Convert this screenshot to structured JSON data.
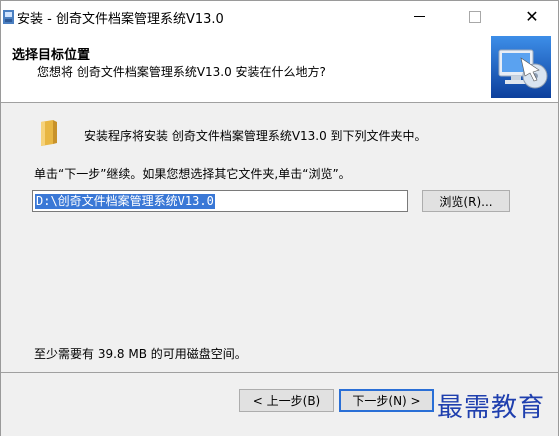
{
  "window": {
    "title": "安装 - 创奇文件档案管理系统V13.0",
    "close_symbol": "✕"
  },
  "header": {
    "title": "选择目标位置",
    "subtitle": "您想将 创奇文件档案管理系统V13.0 安装在什么地方?"
  },
  "body": {
    "intro": "安装程序将安装 创奇文件档案管理系统V13.0 到下列文件夹中。",
    "instruction": "单击“下一步”继续。如果您想选择其它文件夹,单击“浏览”。",
    "path_value": "D:\\创奇文件档案管理系统V13.0",
    "browse_label": "浏览(R)...",
    "space_text": "至少需要有 39.8 MB 的可用磁盘空间。"
  },
  "footer": {
    "back_label": "< 上一步(B)",
    "next_label": "下一步(N) >"
  },
  "watermark": "最需教育",
  "colors": {
    "accent": "#2a6fd6",
    "selection": "#3a78d6",
    "watermark": "#1f3fae"
  },
  "icons": [
    "installer-app-icon",
    "folder-icon",
    "computer-disc-icon",
    "close-icon",
    "minimize-icon",
    "maximize-icon"
  ]
}
